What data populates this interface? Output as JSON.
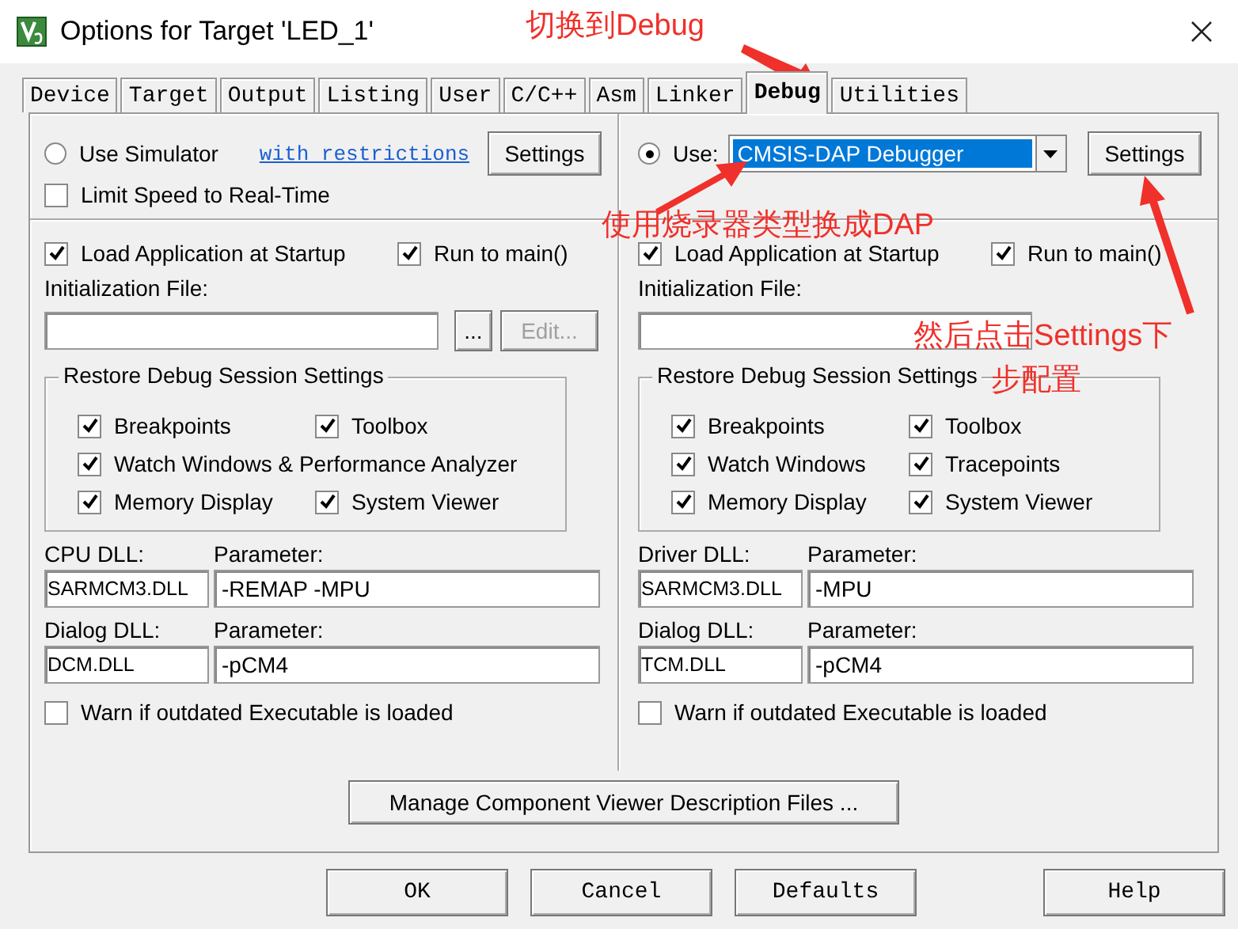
{
  "window": {
    "title": "Options for Target 'LED_1'"
  },
  "tabs": [
    {
      "label": "Device",
      "selected": false
    },
    {
      "label": "Target",
      "selected": false
    },
    {
      "label": "Output",
      "selected": false
    },
    {
      "label": "Listing",
      "selected": false
    },
    {
      "label": "User",
      "selected": false
    },
    {
      "label": "C/C++",
      "selected": false
    },
    {
      "label": "Asm",
      "selected": false
    },
    {
      "label": "Linker",
      "selected": false
    },
    {
      "label": "Debug",
      "selected": true
    },
    {
      "label": "Utilities",
      "selected": false
    }
  ],
  "panels": [
    {
      "source": {
        "label": "Use Simulator",
        "selected": false,
        "link": "with restrictions",
        "settings": "Settings"
      },
      "limit_speed": {
        "label": "Limit Speed to Real-Time",
        "checked": false
      },
      "load_app": {
        "label": "Load Application at Startup",
        "checked": true
      },
      "run_to_main": {
        "label": "Run to main()",
        "checked": true
      },
      "init_file": {
        "label": "Initialization File:",
        "browse": "...",
        "edit": "Edit...",
        "edit_disabled": true
      },
      "restore": {
        "title": "Restore Debug Session Settings",
        "rows": [
          [
            {
              "label": "Breakpoints",
              "checked": true
            },
            {
              "label": "Toolbox",
              "checked": true
            }
          ],
          [
            {
              "label": "Watch Windows & Performance Analyzer",
              "checked": true
            }
          ],
          [
            {
              "label": "Memory Display",
              "checked": true
            },
            {
              "label": "System Viewer",
              "checked": true
            }
          ]
        ]
      },
      "dlls": [
        {
          "dll_label": "CPU DLL:",
          "dll": "SARMCM3.DLL",
          "param_label": "Parameter:",
          "param": "-REMAP -MPU"
        },
        {
          "dll_label": "Dialog DLL:",
          "dll": "DCM.DLL",
          "param_label": "Parameter:",
          "param": "-pCM4"
        }
      ],
      "warn": {
        "label": "Warn if outdated Executable is loaded",
        "checked": false
      }
    },
    {
      "source": {
        "label": "Use:",
        "selected": true,
        "dropdown": "CMSIS-DAP Debugger",
        "settings": "Settings"
      },
      "load_app": {
        "label": "Load Application at Startup",
        "checked": true
      },
      "run_to_main": {
        "label": "Run to main()",
        "checked": true
      },
      "init_file": {
        "label": "Initialization File:"
      },
      "restore": {
        "title": "Restore Debug Session Settings",
        "rows": [
          [
            {
              "label": "Breakpoints",
              "checked": true
            },
            {
              "label": "Toolbox",
              "checked": true
            }
          ],
          [
            {
              "label": "Watch Windows",
              "checked": true
            },
            {
              "label": "Tracepoints",
              "checked": true
            }
          ],
          [
            {
              "label": "Memory Display",
              "checked": true
            },
            {
              "label": "System Viewer",
              "checked": true
            }
          ]
        ]
      },
      "dlls": [
        {
          "dll_label": "Driver DLL:",
          "dll": "SARMCM3.DLL",
          "param_label": "Parameter:",
          "param": "-MPU"
        },
        {
          "dll_label": "Dialog DLL:",
          "dll": "TCM.DLL",
          "param_label": "Parameter:",
          "param": "-pCM4"
        }
      ],
      "warn": {
        "label": "Warn if outdated Executable is loaded",
        "checked": false
      }
    }
  ],
  "manage_button": "Manage Component Viewer Description Files ...",
  "buttons": [
    "OK",
    "Cancel",
    "Defaults",
    "Help"
  ],
  "annotations": [
    "切换到Debug",
    "使用烧录器类型换成DAP",
    "然后点击Settings下",
    "步配置"
  ]
}
